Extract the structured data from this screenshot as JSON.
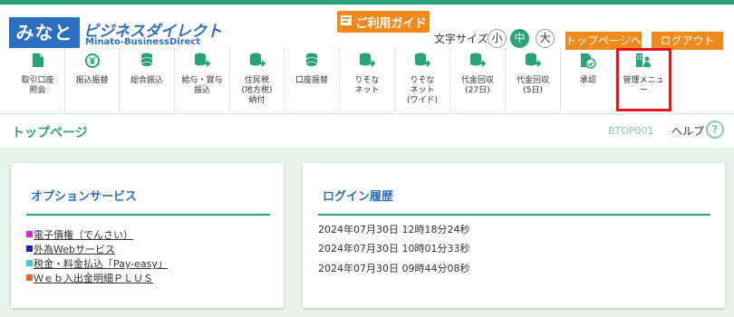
{
  "header": {
    "logo_main": "みなと",
    "logo_word": "ビジネスダイレクト",
    "logo_sub": "Minato-BusinessDirect",
    "guide_label": "ご利用ガイド",
    "fontsize_label": "文字サイズ",
    "fontsize_small": "小",
    "fontsize_medium": "中",
    "fontsize_large": "大",
    "top_page_link": "トップページへ",
    "logout_link": "ログアウト"
  },
  "nav": {
    "items": [
      {
        "label": "取引口座\n照会",
        "icon": "document-icon"
      },
      {
        "label": "振込振替",
        "icon": "yen-transfer-icon"
      },
      {
        "label": "総合振込",
        "icon": "coins-icon"
      },
      {
        "label": "給与・賞与\n振込",
        "icon": "coins-arrow-icon"
      },
      {
        "label": "住民税\n(地方税)\n納付",
        "icon": "coins-arrow-icon"
      },
      {
        "label": "口座振替",
        "icon": "coins-icon"
      },
      {
        "label": "りそな\nネット",
        "icon": "coins-arrow-icon"
      },
      {
        "label": "りそな\nネット\n(ワイド)",
        "icon": "coins-arrow-icon"
      },
      {
        "label": "代金回収\n(27日)",
        "icon": "coins-arrow-icon"
      },
      {
        "label": "代金回収\n(5日)",
        "icon": "coins-arrow-icon"
      },
      {
        "label": "承認",
        "icon": "approve-icon"
      },
      {
        "label": "管理メニュ\nー",
        "icon": "admin-icon"
      }
    ]
  },
  "page": {
    "title": "トップページ",
    "page_id": "BTOP001",
    "help_label": "ヘルプ",
    "help_icon": "?"
  },
  "options": {
    "title": "オプションサービス",
    "items": [
      {
        "label": "電子債権（でんさい）",
        "color": "#e020e0"
      },
      {
        "label": "外為Webサービス",
        "color": "#1a1ad0"
      },
      {
        "label": "税金・料金払込「Pay-easy」",
        "color": "#40c8e8"
      },
      {
        "label": "Ｗｅｂ入出金明細ＰＬＵＳ",
        "color": "#f06020"
      }
    ]
  },
  "login_history": {
    "title": "ログイン履歴",
    "entries": [
      "2024年07月30日 12時18分24秒",
      "2024年07月30日 10時01分33秒",
      "2024年07月30日 09時44分08秒"
    ]
  },
  "colors": {
    "brand_green": "#2aa37a",
    "brand_blue": "#2d6fbf",
    "accent_orange": "#f08a1c",
    "highlight_red": "#e8141c"
  }
}
